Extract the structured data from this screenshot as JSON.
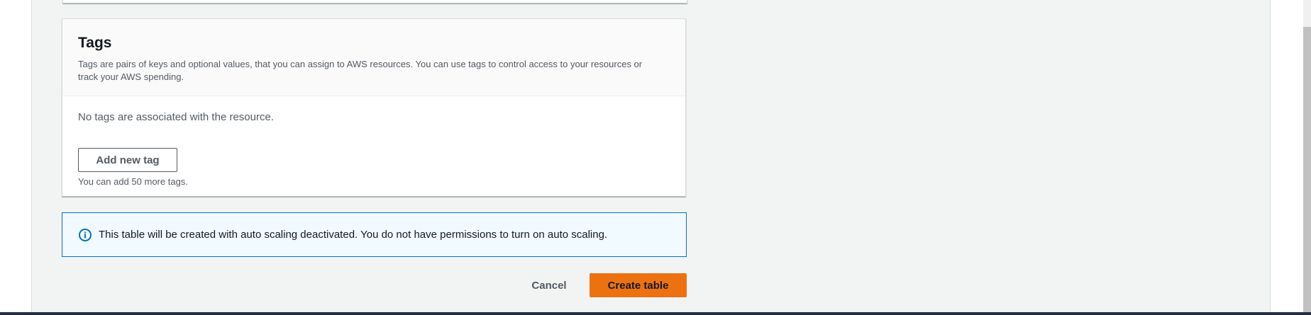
{
  "tags": {
    "title": "Tags",
    "description": "Tags are pairs of keys and optional values, that you can assign to AWS resources. You can use tags to control access to your resources or track your AWS spending.",
    "empty_message": "No tags are associated with the resource.",
    "add_button_label": "Add new tag",
    "limit_text": "You can add 50 more tags."
  },
  "alert": {
    "icon": "info-icon",
    "message": "This table will be created with auto scaling deactivated. You do not have permissions to turn on auto scaling."
  },
  "actions": {
    "cancel_label": "Cancel",
    "create_label": "Create table"
  },
  "colors": {
    "primary_button": "#ec7211",
    "info_border": "#0073bb",
    "info_background": "#f1faff"
  }
}
